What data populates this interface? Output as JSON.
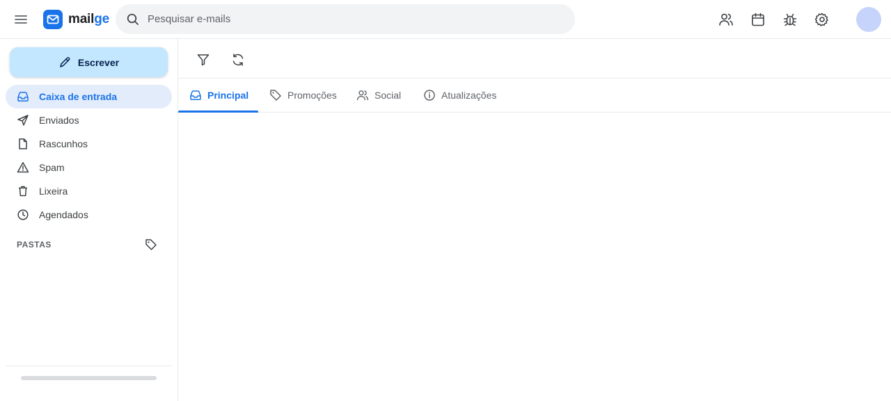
{
  "app": {
    "logo_text_main": "mail",
    "logo_text_accent": "ge",
    "brand_color": "#1a73e8"
  },
  "search": {
    "placeholder": "Pesquisar e-mails",
    "value": ""
  },
  "header_icons": [
    "menu-icon",
    "contacts-icon",
    "calendar-icon",
    "bug-icon",
    "settings-icon"
  ],
  "sidebar": {
    "compose_label": "Escrever",
    "items": [
      {
        "label": "Caixa de entrada",
        "icon": "inbox-icon",
        "active": true
      },
      {
        "label": "Enviados",
        "icon": "send-icon",
        "active": false
      },
      {
        "label": "Rascunhos",
        "icon": "draft-icon",
        "active": false
      },
      {
        "label": "Spam",
        "icon": "warning-icon",
        "active": false
      },
      {
        "label": "Lixeira",
        "icon": "trash-icon",
        "active": false
      },
      {
        "label": "Agendados",
        "icon": "clock-icon",
        "active": false
      }
    ],
    "folders_title": "PASTAS"
  },
  "toolbar": {
    "buttons": [
      "filter-icon",
      "refresh-icon"
    ]
  },
  "tabs": [
    {
      "label": "Principal",
      "icon": "inbox-icon",
      "active": true
    },
    {
      "label": "Promoções",
      "icon": "tag-icon",
      "active": false
    },
    {
      "label": "Social",
      "icon": "people-icon",
      "active": false
    },
    {
      "label": "Atualizações",
      "icon": "info-icon",
      "active": false
    }
  ],
  "colors": {
    "active_text": "#1a73e8",
    "active_bg": "#e3ecfb",
    "compose_bg": "#c2e7ff",
    "avatar_bg": "#c6d4fb"
  }
}
